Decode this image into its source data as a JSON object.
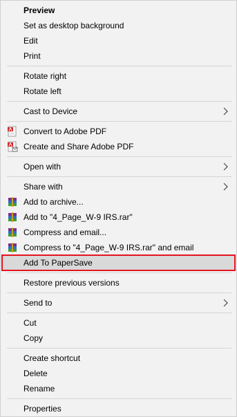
{
  "menu": {
    "preview": "Preview",
    "set_desktop_background": "Set as desktop background",
    "edit": "Edit",
    "print": "Print",
    "rotate_right": "Rotate right",
    "rotate_left": "Rotate left",
    "cast_to_device": "Cast to Device",
    "convert_to_pdf": "Convert to Adobe PDF",
    "create_share_pdf": "Create and Share Adobe PDF",
    "open_with": "Open with",
    "share_with": "Share with",
    "add_to_archive": "Add to archive...",
    "add_to_rar": "Add to \"4_Page_W-9 IRS.rar\"",
    "compress_email": "Compress and email...",
    "compress_rar_email": "Compress to \"4_Page_W-9 IRS.rar\" and email",
    "add_to_papersave": "Add To PaperSave",
    "restore_versions": "Restore previous versions",
    "send_to": "Send to",
    "cut": "Cut",
    "copy": "Copy",
    "create_shortcut": "Create shortcut",
    "delete": "Delete",
    "rename": "Rename",
    "properties": "Properties"
  },
  "icons": {
    "pdf": "adobe-pdf-icon",
    "pdf_share": "adobe-pdf-share-icon",
    "winrar": "winrar-archive-icon",
    "chevron": "chevron-right-icon"
  },
  "colors": {
    "highlight_border": "#e3141f",
    "highlight_background": "#d9d9d9",
    "menu_background": "#f2f2f2"
  }
}
